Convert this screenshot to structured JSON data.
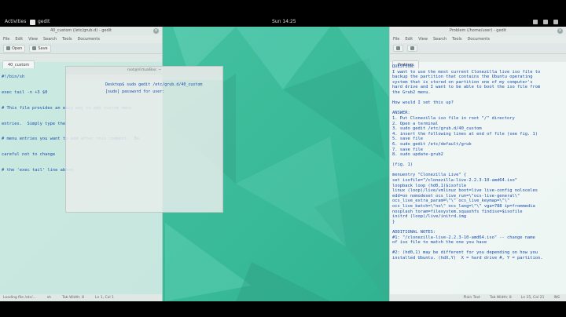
{
  "topbar": {
    "activities": "Activities",
    "app_name": "gedit",
    "clock": "Sun 14:25"
  },
  "left_window": {
    "title": "40_custom (/etc/grub.d) - gedit",
    "menu": [
      "File",
      "Edit",
      "View",
      "Search",
      "Tools",
      "Documents"
    ],
    "toolbar": {
      "open": "Open",
      "save": "Save"
    },
    "tab": "40_custom",
    "lines": [
      "#!/bin/sh",
      "exec tail -n +3 $0",
      "# This file provides an easy way to add custom menu",
      "entries.  Simply type the",
      "# menu entries you want to add after this comment.  Be",
      "careful not to change",
      "# the 'exec tail' line above."
    ],
    "status": [
      "Loading file /etc/...",
      "sh",
      "Tab Width: 8",
      "Ln 1, Col 1"
    ]
  },
  "terminal_window": {
    "title": "root@VirtualBox: ~",
    "line_prefix": "Desktop$ sudo gedit /etc/",
    "line_path": "grub.d/40_custom",
    "password_prompt": "[sudo] password for user:"
  },
  "right_window": {
    "title": "Problem (/home/user) - gedit",
    "menu": [
      "File",
      "Edit",
      "View",
      "Search",
      "Tools",
      "Documents"
    ],
    "tab": "Problem",
    "lines": [
      "QUESTION:",
      "I want to use the most current Clonezilla live iso file to",
      "backup the partition that contains the Ubuntu operating",
      "system that is stored on partition one of my computer's",
      "hard drive and I want to be able to boot the iso file from",
      "the Grub2 menu.",
      "",
      "How would I set this up?",
      "",
      "ANSWER:",
      "1. Put Clonezilla iso file in root \"/\" directory",
      "2. Open a terminal",
      "3. sudo gedit /etc/grub.d/40_custom",
      "4. insert the following lines at end of file (see fig. 1)",
      "5. save file",
      "6. sudo gedit /etc/default/grub",
      "7. save file",
      "8. sudo update-grub2",
      "",
      "(fig. 1)",
      "",
      "menuentry \"Clonezilla Live\" {",
      "set isofile=\"/clonezilla-live-2.2.3-10-amd64.iso\"",
      "loopback loop (hd0,1)$isofile",
      "linux (loop)/live/vmlinuz boot=live live-config noloceles",
      "edd=on nomodeset ocs_live_run=\\\"ocs-live-general\\\"",
      "ocs_live_extra_param=\\\"\\\" ocs_live_keymap=\\\"\\\"",
      "ocs_live_batch=\\\"no\\\" ocs_lang=\\\"\\\" vga=788 ip=frommedia",
      "nosplash toram=filesystem.squashfs findiso=$isofile",
      "initrd (loop)/live/initrd.img",
      "}",
      "",
      "ADDITIONAL NOTES:",
      "#1: \"/clonezilla-live-2.2.3-10-amd64.iso\" -- change name",
      "of iso file to match the one you have",
      "",
      "#2: (hd0,1) may be different for you depending on how you",
      "installed Ubuntu. (hdX,Y)  X = hard drive #, Y = partition."
    ],
    "status": [
      "Plain Text",
      "Tab Width: 8",
      "Ln 15, Col 21",
      "INS"
    ]
  }
}
